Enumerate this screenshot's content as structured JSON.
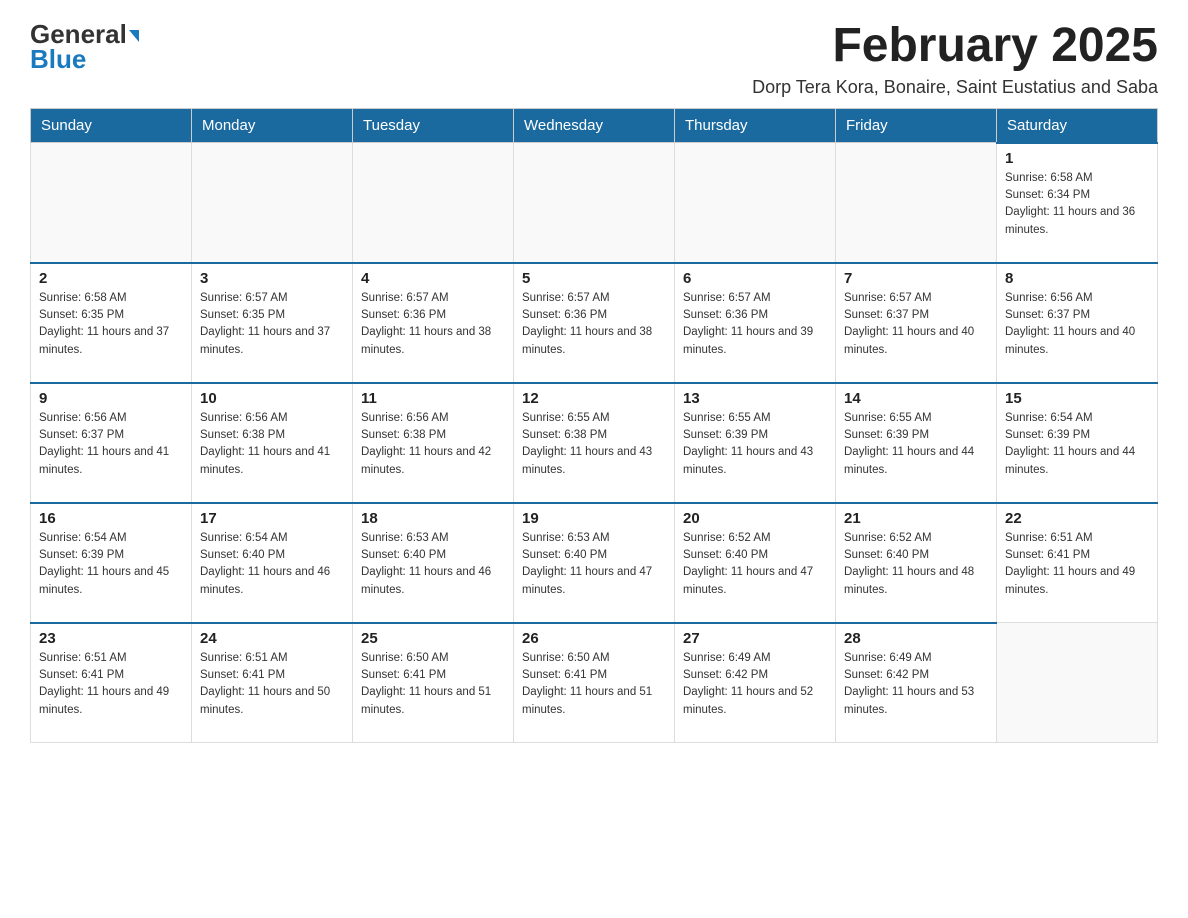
{
  "logo": {
    "text_black": "General",
    "text_blue": "Blue"
  },
  "header": {
    "title": "February 2025",
    "subtitle": "Dorp Tera Kora, Bonaire, Saint Eustatius and Saba"
  },
  "weekdays": [
    "Sunday",
    "Monday",
    "Tuesday",
    "Wednesday",
    "Thursday",
    "Friday",
    "Saturday"
  ],
  "weeks": [
    [
      {
        "day": "",
        "info": ""
      },
      {
        "day": "",
        "info": ""
      },
      {
        "day": "",
        "info": ""
      },
      {
        "day": "",
        "info": ""
      },
      {
        "day": "",
        "info": ""
      },
      {
        "day": "",
        "info": ""
      },
      {
        "day": "1",
        "info": "Sunrise: 6:58 AM\nSunset: 6:34 PM\nDaylight: 11 hours and 36 minutes."
      }
    ],
    [
      {
        "day": "2",
        "info": "Sunrise: 6:58 AM\nSunset: 6:35 PM\nDaylight: 11 hours and 37 minutes."
      },
      {
        "day": "3",
        "info": "Sunrise: 6:57 AM\nSunset: 6:35 PM\nDaylight: 11 hours and 37 minutes."
      },
      {
        "day": "4",
        "info": "Sunrise: 6:57 AM\nSunset: 6:36 PM\nDaylight: 11 hours and 38 minutes."
      },
      {
        "day": "5",
        "info": "Sunrise: 6:57 AM\nSunset: 6:36 PM\nDaylight: 11 hours and 38 minutes."
      },
      {
        "day": "6",
        "info": "Sunrise: 6:57 AM\nSunset: 6:36 PM\nDaylight: 11 hours and 39 minutes."
      },
      {
        "day": "7",
        "info": "Sunrise: 6:57 AM\nSunset: 6:37 PM\nDaylight: 11 hours and 40 minutes."
      },
      {
        "day": "8",
        "info": "Sunrise: 6:56 AM\nSunset: 6:37 PM\nDaylight: 11 hours and 40 minutes."
      }
    ],
    [
      {
        "day": "9",
        "info": "Sunrise: 6:56 AM\nSunset: 6:37 PM\nDaylight: 11 hours and 41 minutes."
      },
      {
        "day": "10",
        "info": "Sunrise: 6:56 AM\nSunset: 6:38 PM\nDaylight: 11 hours and 41 minutes."
      },
      {
        "day": "11",
        "info": "Sunrise: 6:56 AM\nSunset: 6:38 PM\nDaylight: 11 hours and 42 minutes."
      },
      {
        "day": "12",
        "info": "Sunrise: 6:55 AM\nSunset: 6:38 PM\nDaylight: 11 hours and 43 minutes."
      },
      {
        "day": "13",
        "info": "Sunrise: 6:55 AM\nSunset: 6:39 PM\nDaylight: 11 hours and 43 minutes."
      },
      {
        "day": "14",
        "info": "Sunrise: 6:55 AM\nSunset: 6:39 PM\nDaylight: 11 hours and 44 minutes."
      },
      {
        "day": "15",
        "info": "Sunrise: 6:54 AM\nSunset: 6:39 PM\nDaylight: 11 hours and 44 minutes."
      }
    ],
    [
      {
        "day": "16",
        "info": "Sunrise: 6:54 AM\nSunset: 6:39 PM\nDaylight: 11 hours and 45 minutes."
      },
      {
        "day": "17",
        "info": "Sunrise: 6:54 AM\nSunset: 6:40 PM\nDaylight: 11 hours and 46 minutes."
      },
      {
        "day": "18",
        "info": "Sunrise: 6:53 AM\nSunset: 6:40 PM\nDaylight: 11 hours and 46 minutes."
      },
      {
        "day": "19",
        "info": "Sunrise: 6:53 AM\nSunset: 6:40 PM\nDaylight: 11 hours and 47 minutes."
      },
      {
        "day": "20",
        "info": "Sunrise: 6:52 AM\nSunset: 6:40 PM\nDaylight: 11 hours and 47 minutes."
      },
      {
        "day": "21",
        "info": "Sunrise: 6:52 AM\nSunset: 6:40 PM\nDaylight: 11 hours and 48 minutes."
      },
      {
        "day": "22",
        "info": "Sunrise: 6:51 AM\nSunset: 6:41 PM\nDaylight: 11 hours and 49 minutes."
      }
    ],
    [
      {
        "day": "23",
        "info": "Sunrise: 6:51 AM\nSunset: 6:41 PM\nDaylight: 11 hours and 49 minutes."
      },
      {
        "day": "24",
        "info": "Sunrise: 6:51 AM\nSunset: 6:41 PM\nDaylight: 11 hours and 50 minutes."
      },
      {
        "day": "25",
        "info": "Sunrise: 6:50 AM\nSunset: 6:41 PM\nDaylight: 11 hours and 51 minutes."
      },
      {
        "day": "26",
        "info": "Sunrise: 6:50 AM\nSunset: 6:41 PM\nDaylight: 11 hours and 51 minutes."
      },
      {
        "day": "27",
        "info": "Sunrise: 6:49 AM\nSunset: 6:42 PM\nDaylight: 11 hours and 52 minutes."
      },
      {
        "day": "28",
        "info": "Sunrise: 6:49 AM\nSunset: 6:42 PM\nDaylight: 11 hours and 53 minutes."
      },
      {
        "day": "",
        "info": ""
      }
    ]
  ]
}
